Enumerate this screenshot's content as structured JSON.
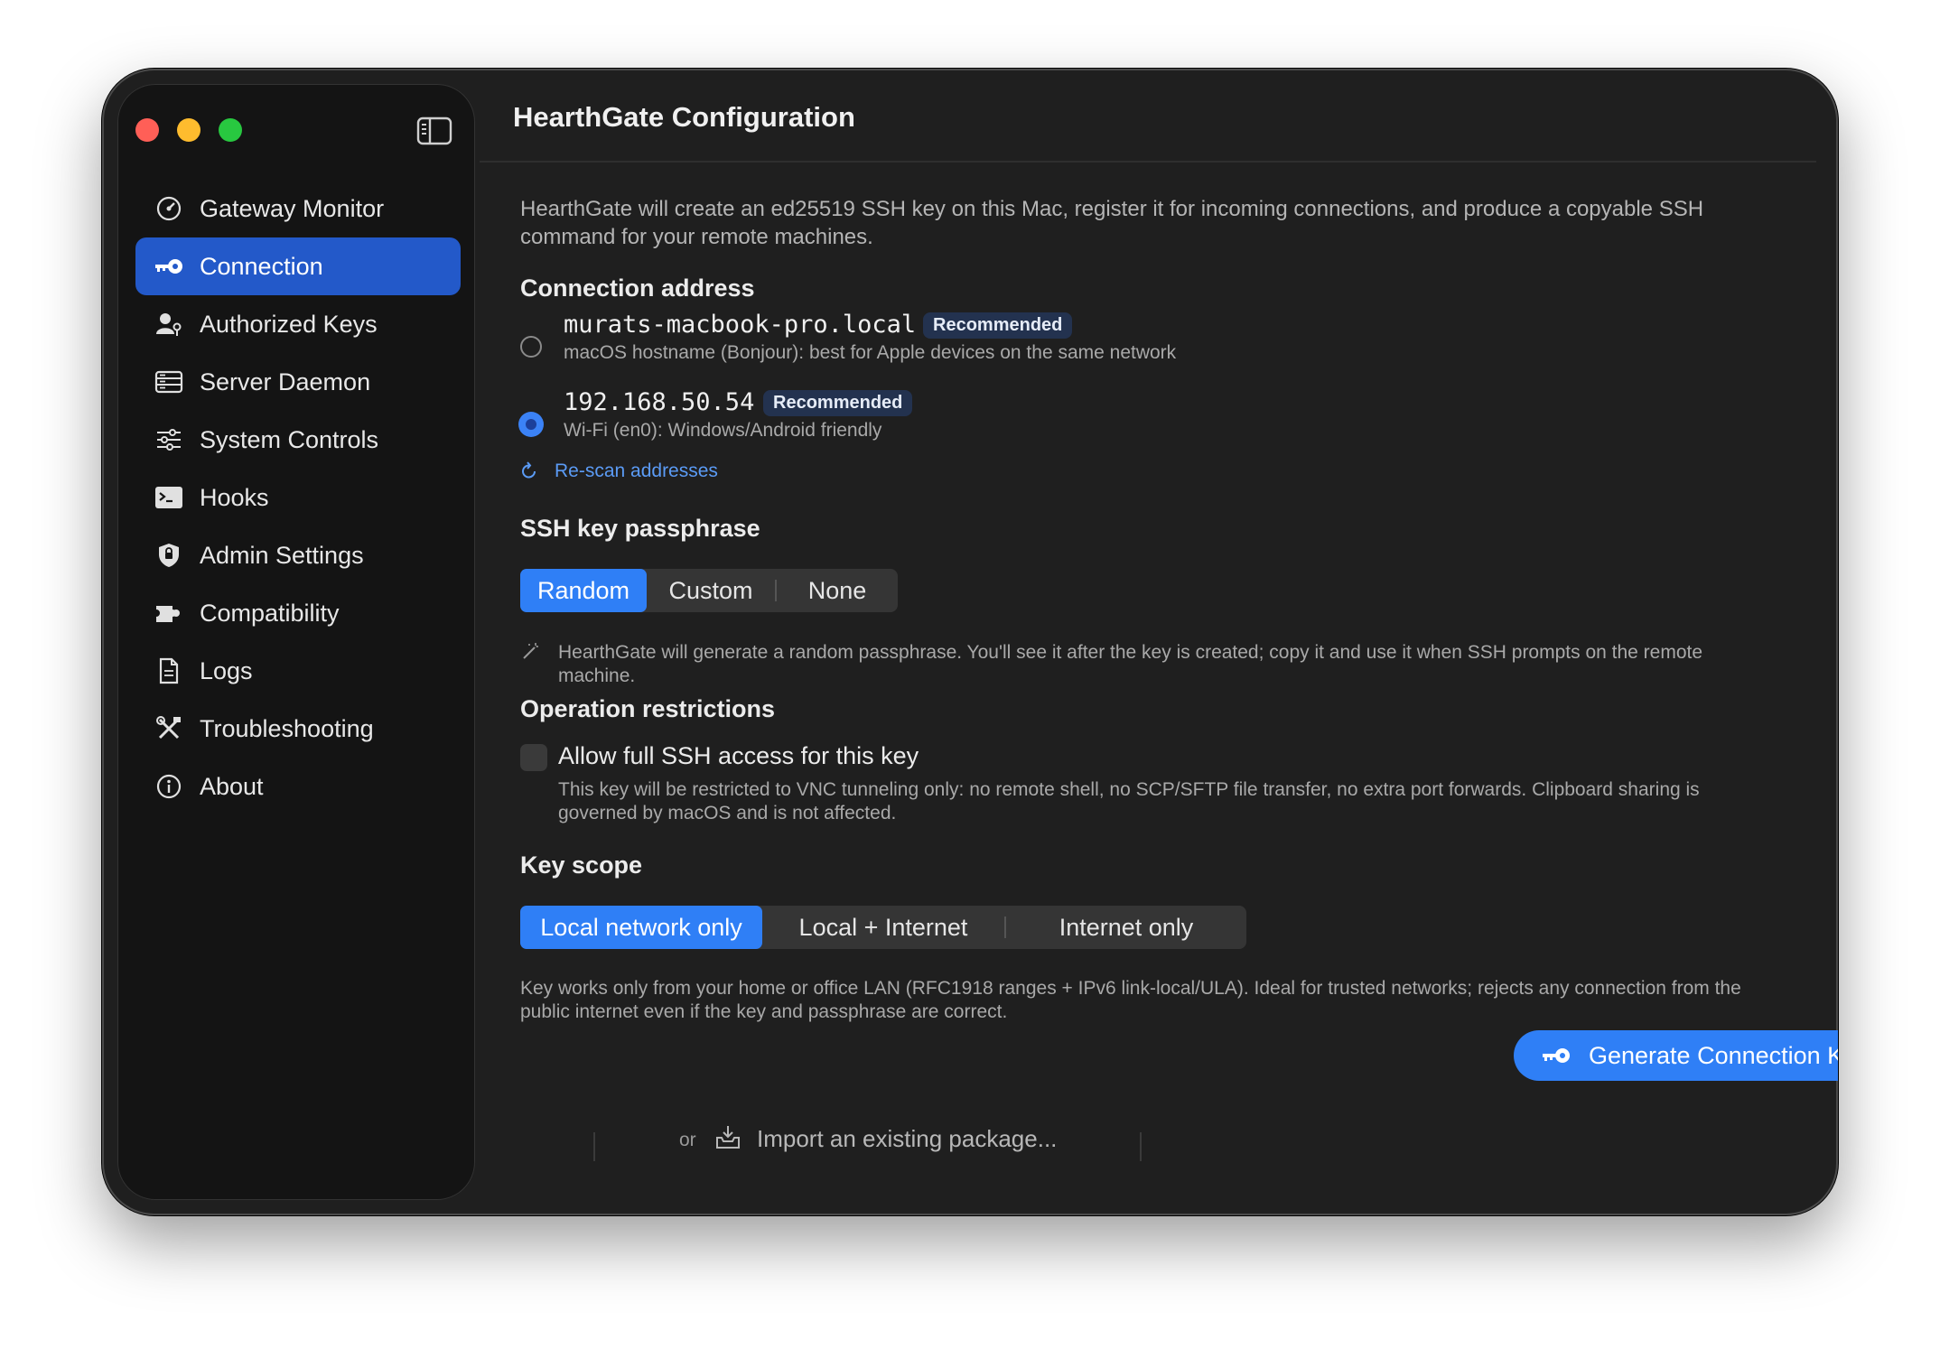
{
  "sidebar": {
    "items": [
      {
        "label": "Gateway Monitor",
        "icon": "gauge-icon"
      },
      {
        "label": "Connection",
        "icon": "key-icon",
        "active": true
      },
      {
        "label": "Authorized Keys",
        "icon": "person-key-icon"
      },
      {
        "label": "Server Daemon",
        "icon": "server-icon"
      },
      {
        "label": "System Controls",
        "icon": "sliders-icon"
      },
      {
        "label": "Hooks",
        "icon": "terminal-icon"
      },
      {
        "label": "Admin Settings",
        "icon": "shield-icon"
      },
      {
        "label": "Compatibility",
        "icon": "puzzle-icon"
      },
      {
        "label": "Logs",
        "icon": "document-icon"
      },
      {
        "label": "Troubleshooting",
        "icon": "tools-icon"
      },
      {
        "label": "About",
        "icon": "info-icon"
      }
    ]
  },
  "main": {
    "title": "HearthGate Configuration",
    "intro": "HearthGate will create an ed25519 SSH key on this Mac, register it for incoming connections, and produce a copyable SSH command for your remote machines.",
    "connection_address": {
      "heading": "Connection address",
      "options": [
        {
          "address": "murats-macbook-pro.local",
          "badge": "Recommended",
          "description": "macOS hostname (Bonjour): best for Apple devices on the same network",
          "selected": false
        },
        {
          "address": "192.168.50.54",
          "badge": "Recommended",
          "description": "Wi-Fi (en0): Windows/Android friendly",
          "selected": true
        }
      ],
      "rescan_label": "Re-scan addresses"
    },
    "passphrase": {
      "heading": "SSH key passphrase",
      "options": [
        "Random",
        "Custom",
        "None"
      ],
      "selected": "Random",
      "note": "HearthGate will generate a random passphrase. You'll see it after the key is created; copy it and use it when SSH prompts on the remote machine."
    },
    "restrictions": {
      "heading": "Operation restrictions",
      "checkbox_label": "Allow full SSH access for this key",
      "checked": false,
      "note": "This key will be restricted to VNC tunneling only: no remote shell, no SCP/SFTP file transfer, no extra port forwards. Clipboard sharing is governed by macOS and is not affected."
    },
    "key_scope": {
      "heading": "Key scope",
      "options": [
        "Local network only",
        "Local + Internet",
        "Internet only"
      ],
      "selected": "Local network only",
      "note": "Key works only from your home or office LAN (RFC1918 ranges + IPv6 link-local/ULA). Ideal for trusted networks; rejects any connection from the public internet even if the key and passphrase are correct."
    },
    "generate_button": "Generate Connection Key",
    "import": {
      "or": "or",
      "label": "Import an existing package..."
    }
  },
  "colors": {
    "accent": "#2f7ff6",
    "sidebar_active": "#2359c9",
    "link": "#5b9bf5"
  }
}
